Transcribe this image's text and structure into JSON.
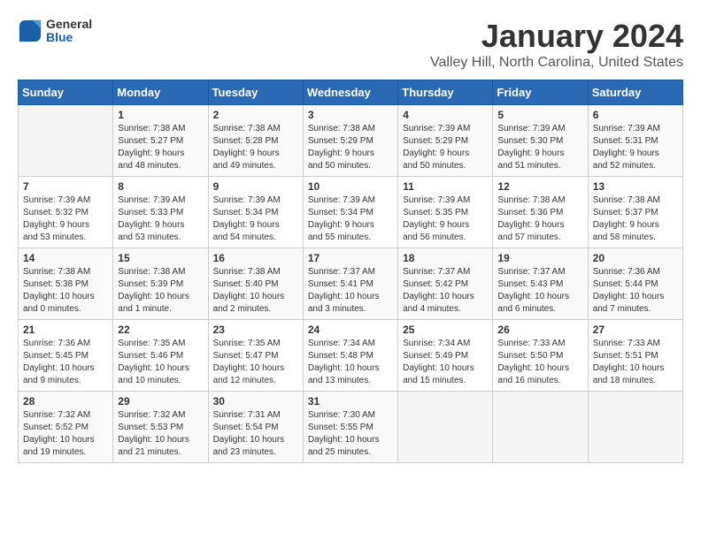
{
  "header": {
    "logo": {
      "general": "General",
      "blue": "Blue"
    },
    "title": "January 2024",
    "subtitle": "Valley Hill, North Carolina, United States"
  },
  "calendar": {
    "days_of_week": [
      "Sunday",
      "Monday",
      "Tuesday",
      "Wednesday",
      "Thursday",
      "Friday",
      "Saturday"
    ],
    "weeks": [
      [
        {
          "day": "",
          "info": ""
        },
        {
          "day": "1",
          "info": "Sunrise: 7:38 AM\nSunset: 5:27 PM\nDaylight: 9 hours\nand 48 minutes."
        },
        {
          "day": "2",
          "info": "Sunrise: 7:38 AM\nSunset: 5:28 PM\nDaylight: 9 hours\nand 49 minutes."
        },
        {
          "day": "3",
          "info": "Sunrise: 7:38 AM\nSunset: 5:29 PM\nDaylight: 9 hours\nand 50 minutes."
        },
        {
          "day": "4",
          "info": "Sunrise: 7:39 AM\nSunset: 5:29 PM\nDaylight: 9 hours\nand 50 minutes."
        },
        {
          "day": "5",
          "info": "Sunrise: 7:39 AM\nSunset: 5:30 PM\nDaylight: 9 hours\nand 51 minutes."
        },
        {
          "day": "6",
          "info": "Sunrise: 7:39 AM\nSunset: 5:31 PM\nDaylight: 9 hours\nand 52 minutes."
        }
      ],
      [
        {
          "day": "7",
          "info": "Sunrise: 7:39 AM\nSunset: 5:32 PM\nDaylight: 9 hours\nand 53 minutes."
        },
        {
          "day": "8",
          "info": "Sunrise: 7:39 AM\nSunset: 5:33 PM\nDaylight: 9 hours\nand 53 minutes."
        },
        {
          "day": "9",
          "info": "Sunrise: 7:39 AM\nSunset: 5:34 PM\nDaylight: 9 hours\nand 54 minutes."
        },
        {
          "day": "10",
          "info": "Sunrise: 7:39 AM\nSunset: 5:34 PM\nDaylight: 9 hours\nand 55 minutes."
        },
        {
          "day": "11",
          "info": "Sunrise: 7:39 AM\nSunset: 5:35 PM\nDaylight: 9 hours\nand 56 minutes."
        },
        {
          "day": "12",
          "info": "Sunrise: 7:38 AM\nSunset: 5:36 PM\nDaylight: 9 hours\nand 57 minutes."
        },
        {
          "day": "13",
          "info": "Sunrise: 7:38 AM\nSunset: 5:37 PM\nDaylight: 9 hours\nand 58 minutes."
        }
      ],
      [
        {
          "day": "14",
          "info": "Sunrise: 7:38 AM\nSunset: 5:38 PM\nDaylight: 10 hours\nand 0 minutes."
        },
        {
          "day": "15",
          "info": "Sunrise: 7:38 AM\nSunset: 5:39 PM\nDaylight: 10 hours\nand 1 minute."
        },
        {
          "day": "16",
          "info": "Sunrise: 7:38 AM\nSunset: 5:40 PM\nDaylight: 10 hours\nand 2 minutes."
        },
        {
          "day": "17",
          "info": "Sunrise: 7:37 AM\nSunset: 5:41 PM\nDaylight: 10 hours\nand 3 minutes."
        },
        {
          "day": "18",
          "info": "Sunrise: 7:37 AM\nSunset: 5:42 PM\nDaylight: 10 hours\nand 4 minutes."
        },
        {
          "day": "19",
          "info": "Sunrise: 7:37 AM\nSunset: 5:43 PM\nDaylight: 10 hours\nand 6 minutes."
        },
        {
          "day": "20",
          "info": "Sunrise: 7:36 AM\nSunset: 5:44 PM\nDaylight: 10 hours\nand 7 minutes."
        }
      ],
      [
        {
          "day": "21",
          "info": "Sunrise: 7:36 AM\nSunset: 5:45 PM\nDaylight: 10 hours\nand 9 minutes."
        },
        {
          "day": "22",
          "info": "Sunrise: 7:35 AM\nSunset: 5:46 PM\nDaylight: 10 hours\nand 10 minutes."
        },
        {
          "day": "23",
          "info": "Sunrise: 7:35 AM\nSunset: 5:47 PM\nDaylight: 10 hours\nand 12 minutes."
        },
        {
          "day": "24",
          "info": "Sunrise: 7:34 AM\nSunset: 5:48 PM\nDaylight: 10 hours\nand 13 minutes."
        },
        {
          "day": "25",
          "info": "Sunrise: 7:34 AM\nSunset: 5:49 PM\nDaylight: 10 hours\nand 15 minutes."
        },
        {
          "day": "26",
          "info": "Sunrise: 7:33 AM\nSunset: 5:50 PM\nDaylight: 10 hours\nand 16 minutes."
        },
        {
          "day": "27",
          "info": "Sunrise: 7:33 AM\nSunset: 5:51 PM\nDaylight: 10 hours\nand 18 minutes."
        }
      ],
      [
        {
          "day": "28",
          "info": "Sunrise: 7:32 AM\nSunset: 5:52 PM\nDaylight: 10 hours\nand 19 minutes."
        },
        {
          "day": "29",
          "info": "Sunrise: 7:32 AM\nSunset: 5:53 PM\nDaylight: 10 hours\nand 21 minutes."
        },
        {
          "day": "30",
          "info": "Sunrise: 7:31 AM\nSunset: 5:54 PM\nDaylight: 10 hours\nand 23 minutes."
        },
        {
          "day": "31",
          "info": "Sunrise: 7:30 AM\nSunset: 5:55 PM\nDaylight: 10 hours\nand 25 minutes."
        },
        {
          "day": "",
          "info": ""
        },
        {
          "day": "",
          "info": ""
        },
        {
          "day": "",
          "info": ""
        }
      ]
    ]
  }
}
